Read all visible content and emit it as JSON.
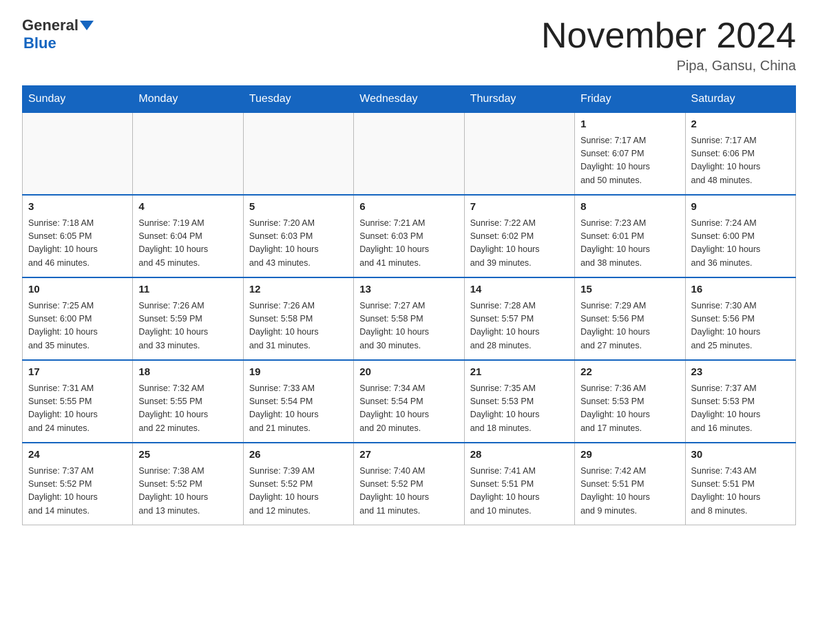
{
  "header": {
    "logo_general": "General",
    "logo_blue": "Blue",
    "title": "November 2024",
    "location": "Pipa, Gansu, China"
  },
  "weekdays": [
    "Sunday",
    "Monday",
    "Tuesday",
    "Wednesday",
    "Thursday",
    "Friday",
    "Saturday"
  ],
  "weeks": [
    [
      {
        "day": "",
        "info": ""
      },
      {
        "day": "",
        "info": ""
      },
      {
        "day": "",
        "info": ""
      },
      {
        "day": "",
        "info": ""
      },
      {
        "day": "",
        "info": ""
      },
      {
        "day": "1",
        "info": "Sunrise: 7:17 AM\nSunset: 6:07 PM\nDaylight: 10 hours\nand 50 minutes."
      },
      {
        "day": "2",
        "info": "Sunrise: 7:17 AM\nSunset: 6:06 PM\nDaylight: 10 hours\nand 48 minutes."
      }
    ],
    [
      {
        "day": "3",
        "info": "Sunrise: 7:18 AM\nSunset: 6:05 PM\nDaylight: 10 hours\nand 46 minutes."
      },
      {
        "day": "4",
        "info": "Sunrise: 7:19 AM\nSunset: 6:04 PM\nDaylight: 10 hours\nand 45 minutes."
      },
      {
        "day": "5",
        "info": "Sunrise: 7:20 AM\nSunset: 6:03 PM\nDaylight: 10 hours\nand 43 minutes."
      },
      {
        "day": "6",
        "info": "Sunrise: 7:21 AM\nSunset: 6:03 PM\nDaylight: 10 hours\nand 41 minutes."
      },
      {
        "day": "7",
        "info": "Sunrise: 7:22 AM\nSunset: 6:02 PM\nDaylight: 10 hours\nand 39 minutes."
      },
      {
        "day": "8",
        "info": "Sunrise: 7:23 AM\nSunset: 6:01 PM\nDaylight: 10 hours\nand 38 minutes."
      },
      {
        "day": "9",
        "info": "Sunrise: 7:24 AM\nSunset: 6:00 PM\nDaylight: 10 hours\nand 36 minutes."
      }
    ],
    [
      {
        "day": "10",
        "info": "Sunrise: 7:25 AM\nSunset: 6:00 PM\nDaylight: 10 hours\nand 35 minutes."
      },
      {
        "day": "11",
        "info": "Sunrise: 7:26 AM\nSunset: 5:59 PM\nDaylight: 10 hours\nand 33 minutes."
      },
      {
        "day": "12",
        "info": "Sunrise: 7:26 AM\nSunset: 5:58 PM\nDaylight: 10 hours\nand 31 minutes."
      },
      {
        "day": "13",
        "info": "Sunrise: 7:27 AM\nSunset: 5:58 PM\nDaylight: 10 hours\nand 30 minutes."
      },
      {
        "day": "14",
        "info": "Sunrise: 7:28 AM\nSunset: 5:57 PM\nDaylight: 10 hours\nand 28 minutes."
      },
      {
        "day": "15",
        "info": "Sunrise: 7:29 AM\nSunset: 5:56 PM\nDaylight: 10 hours\nand 27 minutes."
      },
      {
        "day": "16",
        "info": "Sunrise: 7:30 AM\nSunset: 5:56 PM\nDaylight: 10 hours\nand 25 minutes."
      }
    ],
    [
      {
        "day": "17",
        "info": "Sunrise: 7:31 AM\nSunset: 5:55 PM\nDaylight: 10 hours\nand 24 minutes."
      },
      {
        "day": "18",
        "info": "Sunrise: 7:32 AM\nSunset: 5:55 PM\nDaylight: 10 hours\nand 22 minutes."
      },
      {
        "day": "19",
        "info": "Sunrise: 7:33 AM\nSunset: 5:54 PM\nDaylight: 10 hours\nand 21 minutes."
      },
      {
        "day": "20",
        "info": "Sunrise: 7:34 AM\nSunset: 5:54 PM\nDaylight: 10 hours\nand 20 minutes."
      },
      {
        "day": "21",
        "info": "Sunrise: 7:35 AM\nSunset: 5:53 PM\nDaylight: 10 hours\nand 18 minutes."
      },
      {
        "day": "22",
        "info": "Sunrise: 7:36 AM\nSunset: 5:53 PM\nDaylight: 10 hours\nand 17 minutes."
      },
      {
        "day": "23",
        "info": "Sunrise: 7:37 AM\nSunset: 5:53 PM\nDaylight: 10 hours\nand 16 minutes."
      }
    ],
    [
      {
        "day": "24",
        "info": "Sunrise: 7:37 AM\nSunset: 5:52 PM\nDaylight: 10 hours\nand 14 minutes."
      },
      {
        "day": "25",
        "info": "Sunrise: 7:38 AM\nSunset: 5:52 PM\nDaylight: 10 hours\nand 13 minutes."
      },
      {
        "day": "26",
        "info": "Sunrise: 7:39 AM\nSunset: 5:52 PM\nDaylight: 10 hours\nand 12 minutes."
      },
      {
        "day": "27",
        "info": "Sunrise: 7:40 AM\nSunset: 5:52 PM\nDaylight: 10 hours\nand 11 minutes."
      },
      {
        "day": "28",
        "info": "Sunrise: 7:41 AM\nSunset: 5:51 PM\nDaylight: 10 hours\nand 10 minutes."
      },
      {
        "day": "29",
        "info": "Sunrise: 7:42 AM\nSunset: 5:51 PM\nDaylight: 10 hours\nand 9 minutes."
      },
      {
        "day": "30",
        "info": "Sunrise: 7:43 AM\nSunset: 5:51 PM\nDaylight: 10 hours\nand 8 minutes."
      }
    ]
  ]
}
